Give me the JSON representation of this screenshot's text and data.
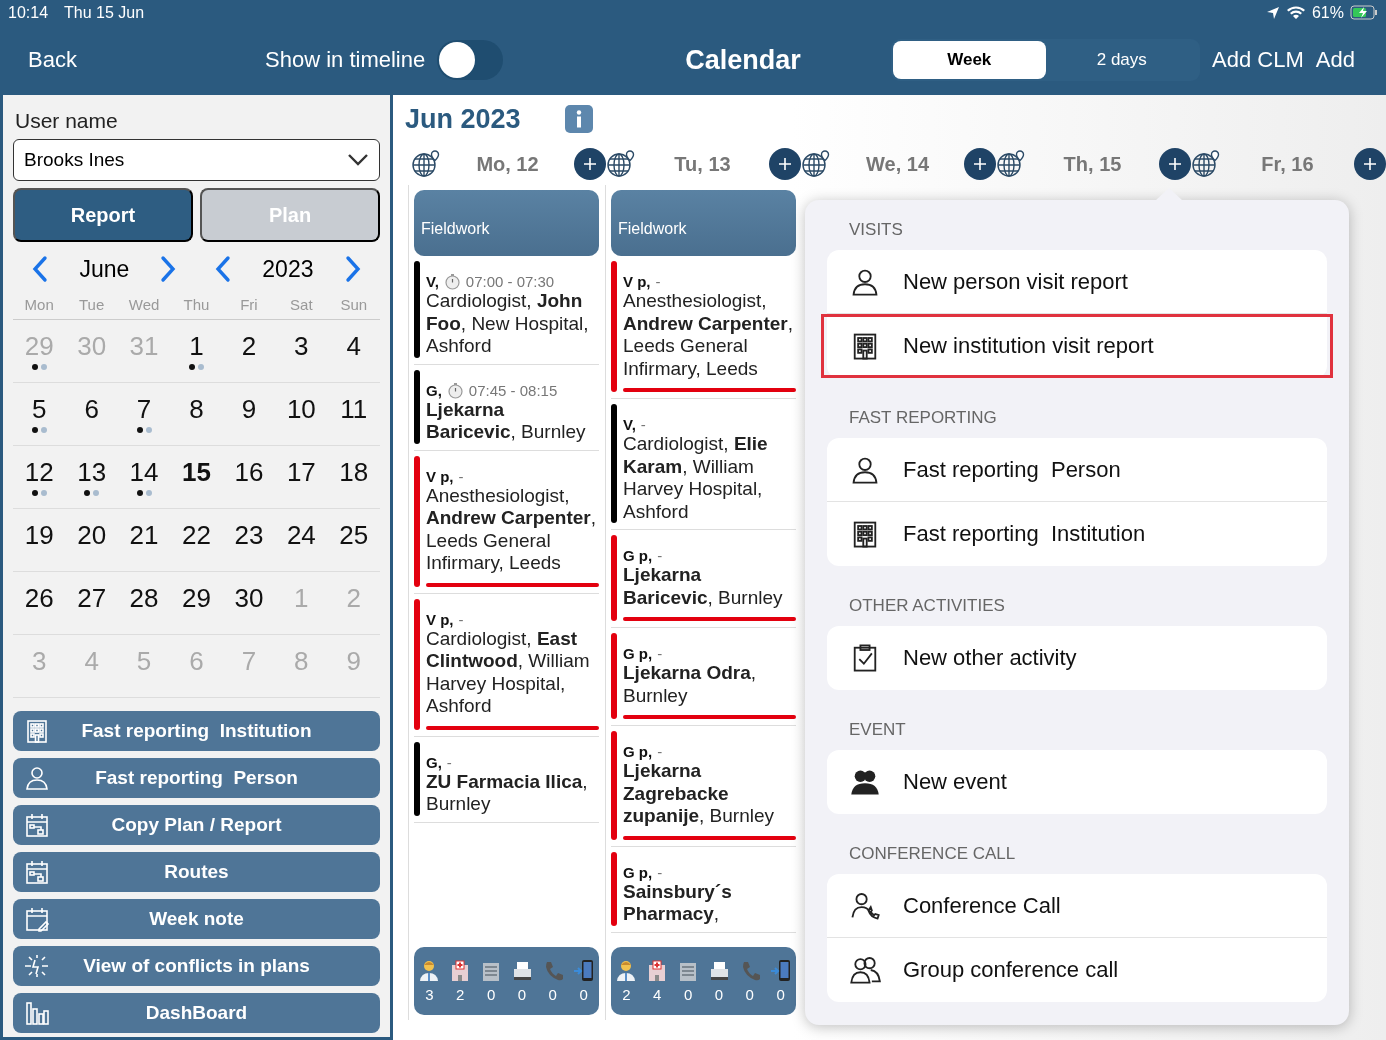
{
  "status_bar": {
    "time": "10:14",
    "date": "Thu 15 Jun",
    "battery": "61%"
  },
  "nav": {
    "back": "Back",
    "timeline_label": "Show in timeline",
    "timeline_on": false,
    "title": "Calendar",
    "views": [
      {
        "label": "Week",
        "selected": true
      },
      {
        "label": "2 days",
        "selected": false
      }
    ],
    "actions": [
      "Add CLM",
      "Add"
    ]
  },
  "sidebar": {
    "user_label": "User name",
    "user_value": "Brooks Ines",
    "modes": [
      {
        "label": "Report",
        "selected": true
      },
      {
        "label": "Plan",
        "selected": false
      }
    ],
    "month": "June",
    "year": "2023",
    "weekdays": [
      "Mon",
      "Tue",
      "Wed",
      "Thu",
      "Fri",
      "Sat",
      "Sun"
    ],
    "weeks": [
      [
        {
          "d": "29",
          "muted": true,
          "events": true,
          "today": false
        },
        {
          "d": "30",
          "muted": true,
          "events": false,
          "today": false
        },
        {
          "d": "31",
          "muted": true,
          "events": false,
          "today": false
        },
        {
          "d": "1",
          "muted": false,
          "events": true,
          "today": false
        },
        {
          "d": "2",
          "muted": false,
          "events": false,
          "today": false
        },
        {
          "d": "3",
          "muted": false,
          "events": false,
          "today": false
        },
        {
          "d": "4",
          "muted": false,
          "events": false,
          "today": false
        }
      ],
      [
        {
          "d": "5",
          "muted": false,
          "events": true,
          "today": false
        },
        {
          "d": "6",
          "muted": false,
          "events": false,
          "today": false
        },
        {
          "d": "7",
          "muted": false,
          "events": true,
          "today": false
        },
        {
          "d": "8",
          "muted": false,
          "events": false,
          "today": false
        },
        {
          "d": "9",
          "muted": false,
          "events": false,
          "today": false
        },
        {
          "d": "10",
          "muted": false,
          "events": false,
          "today": false
        },
        {
          "d": "11",
          "muted": false,
          "events": false,
          "today": false
        }
      ],
      [
        {
          "d": "12",
          "muted": false,
          "events": true,
          "today": false
        },
        {
          "d": "13",
          "muted": false,
          "events": true,
          "today": false
        },
        {
          "d": "14",
          "muted": false,
          "events": true,
          "today": false
        },
        {
          "d": "15",
          "muted": false,
          "events": false,
          "today": true
        },
        {
          "d": "16",
          "muted": false,
          "events": false,
          "today": false
        },
        {
          "d": "17",
          "muted": false,
          "events": false,
          "today": false
        },
        {
          "d": "18",
          "muted": false,
          "events": false,
          "today": false
        }
      ],
      [
        {
          "d": "19",
          "muted": false,
          "events": false,
          "today": false
        },
        {
          "d": "20",
          "muted": false,
          "events": false,
          "today": false
        },
        {
          "d": "21",
          "muted": false,
          "events": false,
          "today": false
        },
        {
          "d": "22",
          "muted": false,
          "events": false,
          "today": false
        },
        {
          "d": "23",
          "muted": false,
          "events": false,
          "today": false
        },
        {
          "d": "24",
          "muted": false,
          "events": false,
          "today": false
        },
        {
          "d": "25",
          "muted": false,
          "events": false,
          "today": false
        }
      ],
      [
        {
          "d": "26",
          "muted": false,
          "events": false,
          "today": false
        },
        {
          "d": "27",
          "muted": false,
          "events": false,
          "today": false
        },
        {
          "d": "28",
          "muted": false,
          "events": false,
          "today": false
        },
        {
          "d": "29",
          "muted": false,
          "events": false,
          "today": false
        },
        {
          "d": "30",
          "muted": false,
          "events": false,
          "today": false
        },
        {
          "d": "1",
          "muted": true,
          "events": false,
          "today": false
        },
        {
          "d": "2",
          "muted": true,
          "events": false,
          "today": false
        }
      ],
      [
        {
          "d": "3",
          "muted": true,
          "events": false,
          "today": false
        },
        {
          "d": "4",
          "muted": true,
          "events": false,
          "today": false
        },
        {
          "d": "5",
          "muted": true,
          "events": false,
          "today": false
        },
        {
          "d": "6",
          "muted": true,
          "events": false,
          "today": false
        },
        {
          "d": "7",
          "muted": true,
          "events": false,
          "today": false
        },
        {
          "d": "8",
          "muted": true,
          "events": false,
          "today": false
        },
        {
          "d": "9",
          "muted": true,
          "events": false,
          "today": false
        }
      ]
    ],
    "buttons": [
      {
        "kind": "institution",
        "label": "Fast reporting  Institution"
      },
      {
        "kind": "person",
        "label": "Fast reporting  Person"
      },
      {
        "kind": "copy",
        "label": "Copy Plan / Report"
      },
      {
        "kind": "copy",
        "label": "Routes"
      },
      {
        "kind": "note",
        "label": "Week note"
      },
      {
        "kind": "conflict",
        "label": "View of conflicts in plans"
      },
      {
        "kind": "chart",
        "label": "DashBoard"
      }
    ]
  },
  "calendar": {
    "month": "Jun 2023",
    "days": [
      "Mo, 12",
      "Tu, 13",
      "We, 14",
      "Th, 15",
      "Fr, 16"
    ],
    "columns": [
      {
        "banner": "Fieldwork",
        "events": [
          {
            "code": "V,",
            "timed": true,
            "time": "07:00 - 07:30",
            "text": "Cardiologist, **John Foo**, New Hospital, Ashford",
            "color": "#000000",
            "underline": false
          },
          {
            "code": "G,",
            "timed": true,
            "time": "07:45 - 08:15",
            "text": "**Ljekarna Baricevic**, Burnley",
            "color": "#000000",
            "underline": false
          },
          {
            "code": "V p,",
            "timed": false,
            "time": "-",
            "text": "Anesthesiologist, **Andrew Carpenter**, Leeds General Infirmary, Leeds",
            "color": "#e3000f",
            "underline": true
          },
          {
            "code": "V p,",
            "timed": false,
            "time": "-",
            "text": "Cardiologist, **East Clintwood**, William Harvey Hospital, Ashford",
            "color": "#e3000f",
            "underline": true
          },
          {
            "code": "G,",
            "timed": false,
            "time": "-",
            "text": "**ZU Farmacia Ilica**, Burnley",
            "color": "#000000",
            "underline": false
          }
        ],
        "stats": [
          {
            "kind": "doctor",
            "count": "3"
          },
          {
            "kind": "hospital",
            "count": "2"
          },
          {
            "kind": "building",
            "count": "0"
          },
          {
            "kind": "fax",
            "count": "0"
          },
          {
            "kind": "phone",
            "count": "0"
          },
          {
            "kind": "mobile",
            "count": "0"
          }
        ]
      },
      {
        "banner": "Fieldwork",
        "events": [
          {
            "code": "V p,",
            "timed": false,
            "time": "-",
            "text": "Anesthesiologist, **Andrew Carpenter**, Leeds General Infirmary, Leeds",
            "color": "#e3000f",
            "underline": true
          },
          {
            "code": "V,",
            "timed": false,
            "time": "-",
            "text": "Cardiologist, **Elie Karam**, William Harvey Hospital, Ashford",
            "color": "#000000",
            "underline": false
          },
          {
            "code": "G p,",
            "timed": false,
            "time": "-",
            "text": "**Ljekarna Baricevic**, Burnley",
            "color": "#e3000f",
            "underline": true
          },
          {
            "code": "G p,",
            "timed": false,
            "time": "-",
            "text": "**Ljekarna Odra**, Burnley",
            "color": "#e3000f",
            "underline": true
          },
          {
            "code": "G p,",
            "timed": false,
            "time": "-",
            "text": "**Ljekarna Zagrebacke zupanije**, Burnley",
            "color": "#e3000f",
            "underline": true
          },
          {
            "code": "G p,",
            "timed": false,
            "time": "-",
            "text": "**Sainsbury´s Pharmacy**,",
            "color": "#e3000f",
            "underline": false
          }
        ],
        "stats": [
          {
            "kind": "doctor",
            "count": "2"
          },
          {
            "kind": "hospital",
            "count": "4"
          },
          {
            "kind": "building",
            "count": "0"
          },
          {
            "kind": "fax",
            "count": "0"
          },
          {
            "kind": "phone",
            "count": "0"
          },
          {
            "kind": "mobile",
            "count": "0"
          }
        ]
      }
    ]
  },
  "popup": {
    "sections": [
      {
        "title": "VISITS",
        "items": [
          {
            "kind": "person",
            "label": "New person visit report",
            "highlighted": false
          },
          {
            "kind": "institution",
            "label": "New institution visit report",
            "highlighted": true
          }
        ]
      },
      {
        "title": "FAST REPORTING",
        "items": [
          {
            "kind": "person",
            "label": "Fast reporting  Person",
            "highlighted": false
          },
          {
            "kind": "institution",
            "label": "Fast reporting  Institution",
            "highlighted": false
          }
        ]
      },
      {
        "title": "OTHER ACTIVITIES",
        "items": [
          {
            "kind": "activity",
            "label": "New other activity",
            "highlighted": false
          }
        ]
      },
      {
        "title": "EVENT",
        "items": [
          {
            "kind": "event",
            "label": "New event",
            "highlighted": false
          }
        ]
      },
      {
        "title": "CONFERENCE CALL",
        "items": [
          {
            "kind": "conference",
            "label": "Conference Call",
            "highlighted": false
          },
          {
            "kind": "group",
            "label": "Group conference call",
            "highlighted": false
          }
        ]
      }
    ]
  }
}
